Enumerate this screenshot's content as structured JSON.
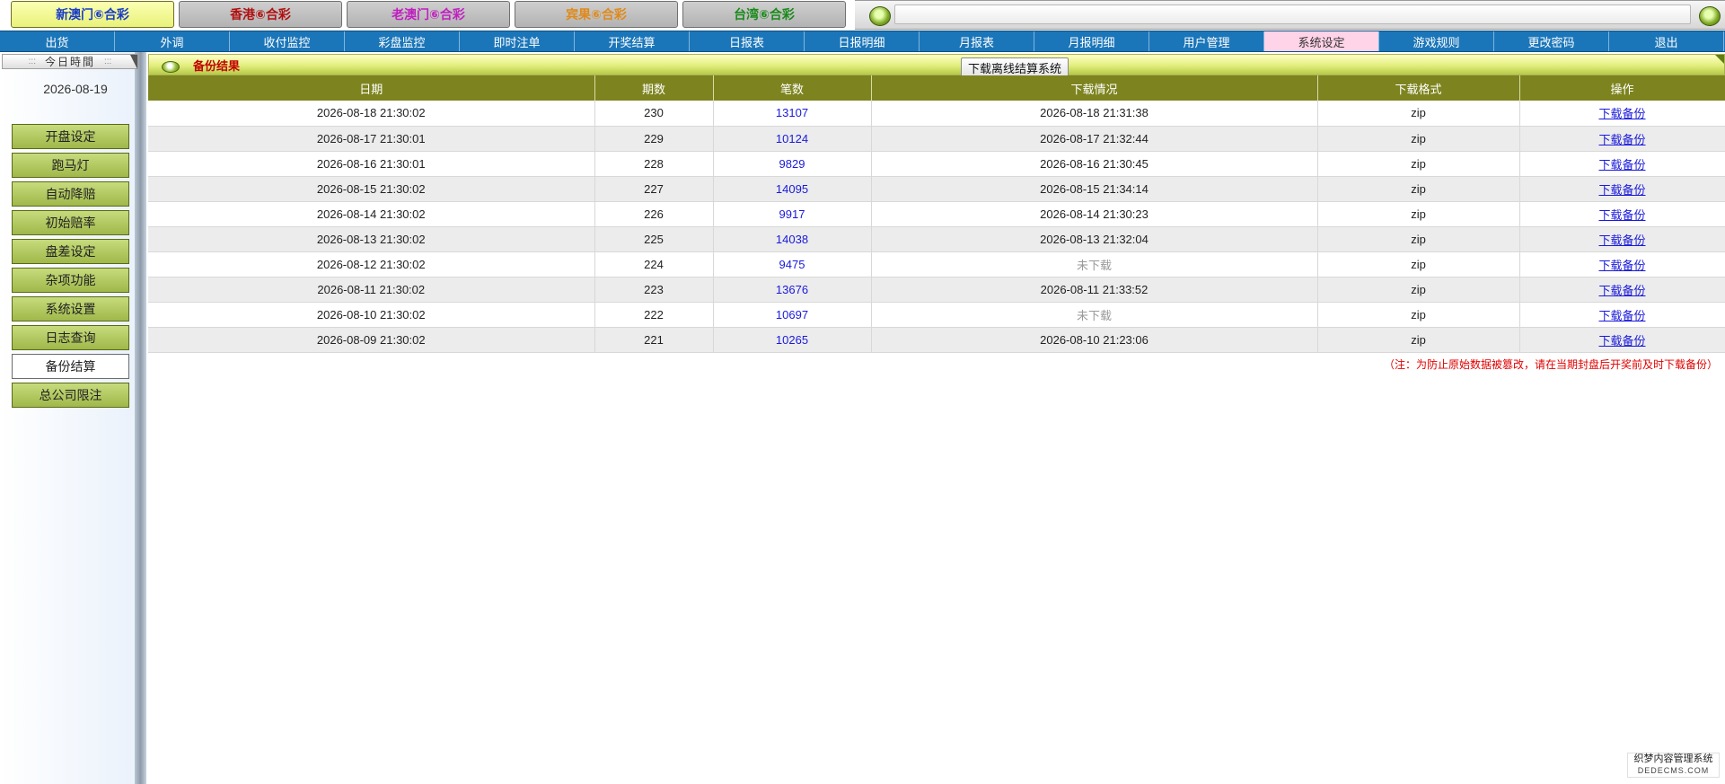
{
  "lottery_tabs": [
    {
      "label": "新澳门⑥合彩",
      "color": "#1a3cc8",
      "active": true
    },
    {
      "label": "香港⑥合彩",
      "color": "#b01010",
      "active": false
    },
    {
      "label": "老澳门⑥合彩",
      "color": "#c020c0",
      "active": false
    },
    {
      "label": "宾果⑥合彩",
      "color": "#e08a1a",
      "active": false
    },
    {
      "label": "台湾⑥合彩",
      "color": "#1a8a1a",
      "active": false
    }
  ],
  "nav": {
    "items": [
      "出货",
      "外调",
      "收付监控",
      "彩盘监控",
      "即时注单",
      "开奖结算",
      "日报表",
      "日报明细",
      "月报表",
      "月报明细",
      "用户管理",
      "系统设定",
      "游戏规则",
      "更改密码",
      "退出"
    ],
    "active_index": 11
  },
  "sidebar": {
    "time_header": "今日時間",
    "today_date": "2026-08-19",
    "buttons": [
      "开盘设定",
      "跑马灯",
      "自动降赔",
      "初始赔率",
      "盘差设定",
      "杂项功能",
      "系统设置",
      "日志查询",
      "备份结算",
      "总公司限注"
    ],
    "active_index": 8
  },
  "main": {
    "title": "备份结果",
    "offline_button": "下载离线结算系统",
    "columns": [
      "日期",
      "期数",
      "笔数",
      "下载情况",
      "下载格式",
      "操作"
    ],
    "rows": [
      {
        "date": "2026-08-18 21:30:02",
        "period": "230",
        "count": "13107",
        "download": "2026-08-18 21:31:38",
        "format": "zip",
        "action": "下载备份",
        "downloaded": true
      },
      {
        "date": "2026-08-17 21:30:01",
        "period": "229",
        "count": "10124",
        "download": "2026-08-17 21:32:44",
        "format": "zip",
        "action": "下载备份",
        "downloaded": true
      },
      {
        "date": "2026-08-16 21:30:01",
        "period": "228",
        "count": "9829",
        "download": "2026-08-16 21:30:45",
        "format": "zip",
        "action": "下载备份",
        "downloaded": true
      },
      {
        "date": "2026-08-15 21:30:02",
        "period": "227",
        "count": "14095",
        "download": "2026-08-15 21:34:14",
        "format": "zip",
        "action": "下载备份",
        "downloaded": true
      },
      {
        "date": "2026-08-14 21:30:02",
        "period": "226",
        "count": "9917",
        "download": "2026-08-14 21:30:23",
        "format": "zip",
        "action": "下载备份",
        "downloaded": true
      },
      {
        "date": "2026-08-13 21:30:02",
        "period": "225",
        "count": "14038",
        "download": "2026-08-13 21:32:04",
        "format": "zip",
        "action": "下载备份",
        "downloaded": true
      },
      {
        "date": "2026-08-12 21:30:02",
        "period": "224",
        "count": "9475",
        "download": "未下载",
        "format": "zip",
        "action": "下载备份",
        "downloaded": false
      },
      {
        "date": "2026-08-11 21:30:02",
        "period": "223",
        "count": "13676",
        "download": "2026-08-11 21:33:52",
        "format": "zip",
        "action": "下载备份",
        "downloaded": true
      },
      {
        "date": "2026-08-10 21:30:02",
        "period": "222",
        "count": "10697",
        "download": "未下载",
        "format": "zip",
        "action": "下载备份",
        "downloaded": false
      },
      {
        "date": "2026-08-09 21:30:02",
        "period": "221",
        "count": "10265",
        "download": "2026-08-10 21:23:06",
        "format": "zip",
        "action": "下载备份",
        "downloaded": true
      }
    ],
    "note": "（注：为防止原始数据被篡改，请在当期封盘后开奖前及时下载备份）"
  },
  "watermark": {
    "line1": "织梦内容管理系统",
    "line2": "DEDECMS.COM"
  },
  "colors": {
    "nav_bg": "#1b76b9",
    "nav_active": "#ffd3e8",
    "table_header": "#7d841f",
    "link": "#1a1adb",
    "note": "#e00000"
  }
}
